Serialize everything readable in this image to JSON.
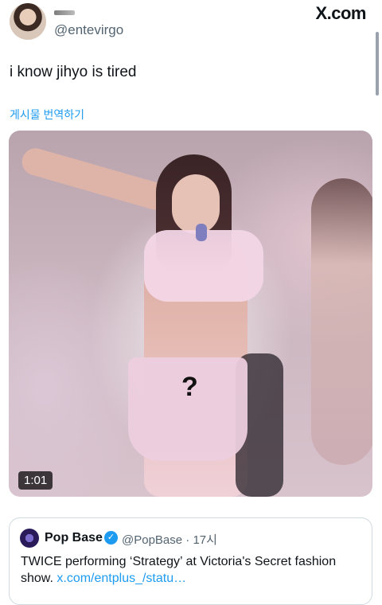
{
  "header": {
    "handle": "@entevirgo",
    "site_label": "X.com"
  },
  "tweet": {
    "text": "i know jihyo is tired",
    "translate_label": "게시물 번역하기"
  },
  "media": {
    "overlay_mark": "?",
    "duration": "1:01"
  },
  "quoted": {
    "name": "Pop Base",
    "handle": "@PopBase",
    "time": "17시",
    "verified_glyph": "✓",
    "text": "TWICE performing ‘Strategy’ at Victoria's Secret fashion show.",
    "link": "x.com/entplus_/statu…"
  },
  "colors": {
    "accent": "#1d9bf0",
    "text": "#0f1419",
    "muted": "#536471"
  }
}
